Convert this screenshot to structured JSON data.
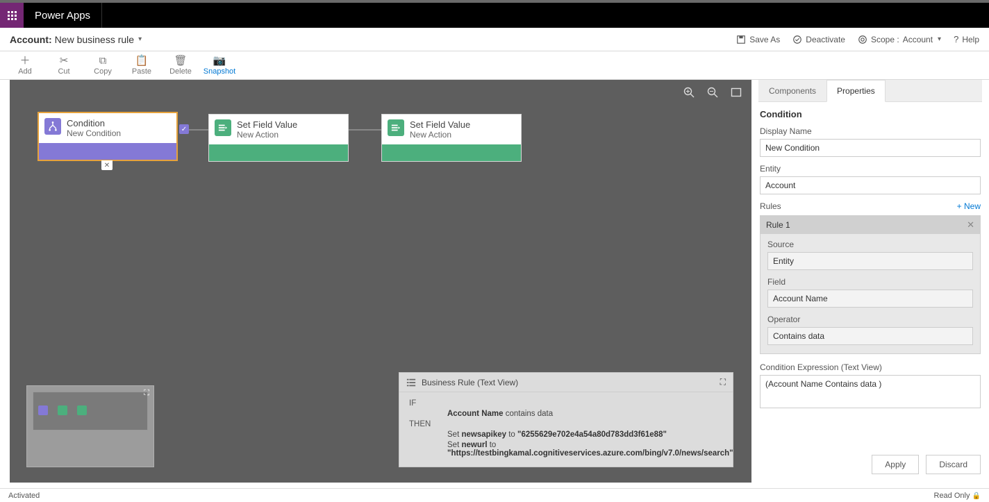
{
  "brand": "Power Apps",
  "crumb": {
    "entity": "Account:",
    "name": "New business rule"
  },
  "crumbActions": {
    "saveAs": "Save As",
    "deactivate": "Deactivate",
    "scopeLabel": "Scope :",
    "scopeValue": "Account",
    "help": "Help"
  },
  "cmd": {
    "add": "Add",
    "cut": "Cut",
    "copy": "Copy",
    "paste": "Paste",
    "delete": "Delete",
    "snapshot": "Snapshot"
  },
  "nodes": {
    "cond": {
      "title": "Condition",
      "sub": "New Condition"
    },
    "a1": {
      "title": "Set Field Value",
      "sub": "New Action"
    },
    "a2": {
      "title": "Set Field Value",
      "sub": "New Action"
    }
  },
  "textView": {
    "title": "Business Rule (Text View)",
    "ifKw": "IF",
    "thenKw": "THEN",
    "ifField": "Account Name",
    "ifRest": " contains data",
    "thenPre": "Set ",
    "l1f": "newsapikey",
    "l1mid": " to ",
    "l1v": "\"6255629e702e4a54a80d783dd3f61e88\"",
    "l2f": "newurl",
    "l2mid": " to ",
    "l2v": "\"https://testbingkamal.cognitiveservices.azure.com/bing/v7.0/news/search\""
  },
  "tabs": {
    "components": "Components",
    "properties": "Properties"
  },
  "props": {
    "heading": "Condition",
    "displayNameLbl": "Display Name",
    "displayName": "New Condition",
    "entityLbl": "Entity",
    "entity": "Account",
    "rulesLbl": "Rules",
    "newLink": "+ New",
    "rule1": "Rule 1",
    "sourceLbl": "Source",
    "source": "Entity",
    "fieldLbl": "Field",
    "field": "Account Name",
    "operatorLbl": "Operator",
    "operator": "Contains data",
    "exprLbl": "Condition Expression (Text View)",
    "expr": "(Account Name Contains data )"
  },
  "buttons": {
    "apply": "Apply",
    "discard": "Discard"
  },
  "footer": {
    "status": "Activated",
    "readonly": "Read Only"
  }
}
